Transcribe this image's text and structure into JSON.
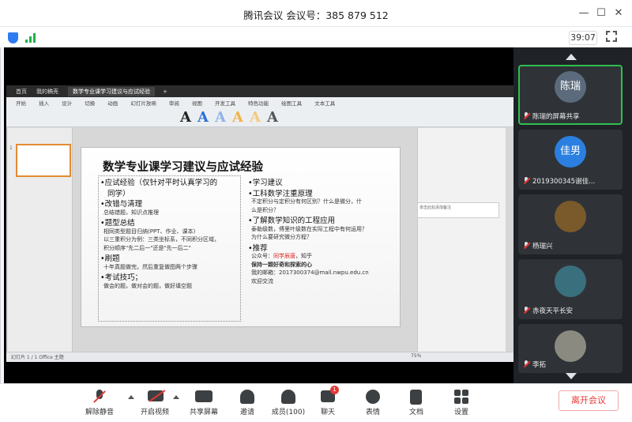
{
  "window": {
    "title": "腾讯会议  会议号：385 879 512"
  },
  "status": {
    "timer": "39:07"
  },
  "presentation": {
    "tabs": [
      "首页",
      "我的稿壳",
      "数学专业课学习建议与应试经验",
      "+"
    ],
    "menu": "开始 插入 设计 切换 动画 幻灯片放映 审阅 视图 开发工具 特色功能 绘图工具 文本工具",
    "slide_title": "数学专业课学习建议与应试经验",
    "left_col": [
      {
        "text": "•应试经验（仅针对平时认真学习的",
        "kind": "bullet"
      },
      {
        "text": "同学）",
        "kind": "bullet-cont"
      },
      {
        "text": "•改错与清理",
        "kind": "bullet"
      },
      {
        "text": "总结错题，知识点推理",
        "kind": "sub"
      },
      {
        "text": "•题型总结",
        "kind": "bullet"
      },
      {
        "text": "相同类型题目归纳(PPT、作业、课本)",
        "kind": "sub"
      },
      {
        "text": "以三重积分为例：三类坐标系，不同积分区域，",
        "kind": "sub"
      },
      {
        "text": "积分顺序\"先二后一\"还是\"先一后二\"",
        "kind": "sub"
      },
      {
        "text": "•刷题",
        "kind": "bullet"
      },
      {
        "text": "十年真题做完，然后重复做图两个步骤",
        "kind": "sub"
      },
      {
        "text": "•考试技巧；",
        "kind": "bullet"
      },
      {
        "text": "做会的题，做对会的题，做好填空题",
        "kind": "sub"
      }
    ],
    "right_col": [
      {
        "text": "•学习建议",
        "kind": "bullet"
      },
      {
        "text": "•工科数学注重原理",
        "kind": "bullet"
      },
      {
        "text": "不定积分与定积分有何区别？什么是微分，什",
        "kind": "sub"
      },
      {
        "text": "么是积分？",
        "kind": "sub"
      },
      {
        "text": "•了解数学知识的工程应用",
        "kind": "bullet"
      },
      {
        "text": "泰勒级数，傅里叶级数在实际工程中有何运用？",
        "kind": "sub"
      },
      {
        "text": "为什么要研究微分方程？",
        "kind": "sub"
      },
      {
        "text": "•推荐",
        "kind": "bullet"
      },
      {
        "text": "公众号：",
        "kind": "sub",
        "red": "同学辰唐",
        "after": "，知乎"
      },
      {
        "text": "保持一颗好奇和探索的心",
        "kind": "sub-bold"
      },
      {
        "text": "我的邮箱：2017300374@mail.nwpu.edu.cn",
        "kind": "sub"
      },
      {
        "text": "欢迎交流",
        "kind": "sub"
      }
    ],
    "notes_placeholder": "单击此处添加备注",
    "status_left": "幻灯片 1 / 1   Office 主题",
    "zoom": "75%"
  },
  "participants": [
    {
      "avatar": "陈瑞",
      "label": "陈瑞的屏幕共享",
      "color": "#5b6b7c",
      "active": true
    },
    {
      "avatar": "佳男",
      "label": "2019300345谢佳...",
      "color": "#2b7fe0"
    },
    {
      "avatar": "",
      "label": "杨瑞兴",
      "color": "#7a5a2a"
    },
    {
      "avatar": "",
      "label": "赤夜天平长安",
      "color": "#3a6f7d"
    },
    {
      "avatar": "",
      "label": "李拓",
      "color": "#8a8a80"
    }
  ],
  "toolbar": {
    "unmute": "解除静音",
    "video": "开启视频",
    "share": "共享屏幕",
    "invite": "邀请",
    "members": "成员(100)",
    "chat": "聊天",
    "chat_badge": "1",
    "reactions": "表情",
    "docs": "文档",
    "settings": "设置",
    "leave": "离开会议"
  }
}
